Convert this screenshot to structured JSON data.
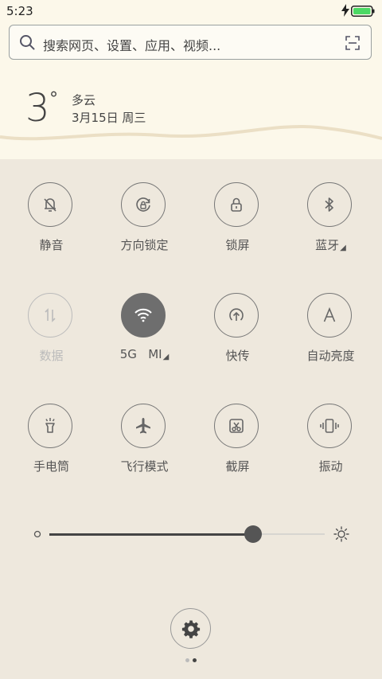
{
  "status_bar": {
    "time": "5:23",
    "battery_color": "#4cd964"
  },
  "search": {
    "placeholder": "搜索网页、设置、应用、视频..."
  },
  "weather": {
    "temperature": "3",
    "degree_symbol": "°",
    "condition": "多云",
    "date": "3月15日 周三"
  },
  "toggles": [
    {
      "label": "静音",
      "icon": "bell-off-icon",
      "state": "off"
    },
    {
      "label": "方向锁定",
      "icon": "rotation-lock-icon",
      "state": "off"
    },
    {
      "label": "锁屏",
      "icon": "lock-icon",
      "state": "off"
    },
    {
      "label": "蓝牙",
      "icon": "bluetooth-icon",
      "state": "off",
      "has_dropdown": true
    },
    {
      "label": "数据",
      "icon": "mobile-data-icon",
      "state": "disabled"
    },
    {
      "label": "5G   MI",
      "icon": "wifi-icon",
      "state": "on",
      "has_dropdown": true
    },
    {
      "label": "快传",
      "icon": "quick-share-icon",
      "state": "off"
    },
    {
      "label": "自动亮度",
      "icon": "auto-brightness-icon",
      "state": "off"
    },
    {
      "label": "手电筒",
      "icon": "flashlight-icon",
      "state": "off"
    },
    {
      "label": "飞行模式",
      "icon": "airplane-icon",
      "state": "off"
    },
    {
      "label": "截屏",
      "icon": "screenshot-icon",
      "state": "off"
    },
    {
      "label": "振动",
      "icon": "vibrate-icon",
      "state": "off"
    }
  ],
  "brightness": {
    "value": 0.74
  },
  "settings": {
    "icon": "gear-icon"
  },
  "pager": {
    "pages": 2,
    "active": 1
  },
  "colors": {
    "accent_on": "#6e6e6e",
    "page_bg": "#eee8dd",
    "header_bg": "#fcf8ea"
  }
}
